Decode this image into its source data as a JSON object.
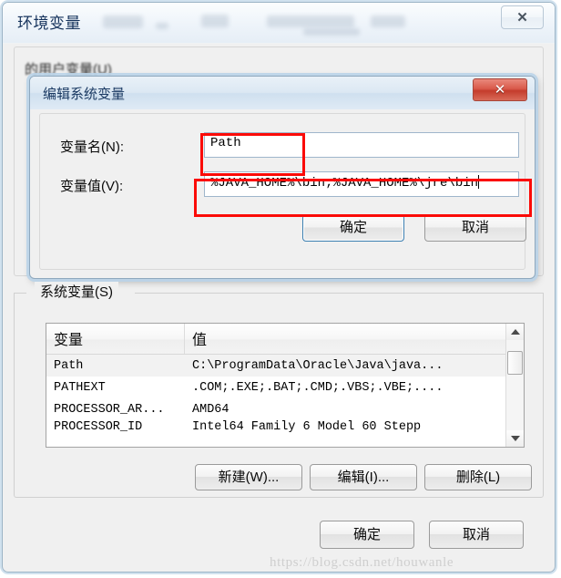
{
  "main_window": {
    "title": "环境变量",
    "close_label": "✕",
    "user_section_label": "的用户变量(U)",
    "ok_label": "确定",
    "cancel_label": "取消"
  },
  "system_section": {
    "label": "系统变量(S)",
    "columns": [
      "变量",
      "值"
    ],
    "rows": [
      {
        "name": "Path",
        "value": "C:\\ProgramData\\Oracle\\Java\\java..."
      },
      {
        "name": "PATHEXT",
        "value": ".COM;.EXE;.BAT;.CMD;.VBS;.VBE;...."
      },
      {
        "name": "PROCESSOR_AR...",
        "value": "AMD64"
      },
      {
        "name": "PROCESSOR_ID",
        "value": "Intel64 Family 6 Model 60 Stepp"
      }
    ],
    "buttons": {
      "new": "新建(W)...",
      "edit": "编辑(I)...",
      "delete": "删除(L)"
    }
  },
  "edit_dialog": {
    "title": "编辑系统变量",
    "close_label": "✕",
    "name_label": "变量名(N):",
    "name_value": "Path",
    "value_label": "变量值(V):",
    "value_value": "%JAVA_HOME%\\bin;%JAVA_HOME%\\jre\\bin",
    "ok_label": "确定",
    "cancel_label": "取消"
  },
  "watermark": "https://blog.csdn.net/houwanle",
  "colors": {
    "annotation_red": "#fb0b08",
    "title_navy": "#16335c",
    "close_red": "#c43c2c",
    "focus_blue": "#3c7fb1"
  }
}
